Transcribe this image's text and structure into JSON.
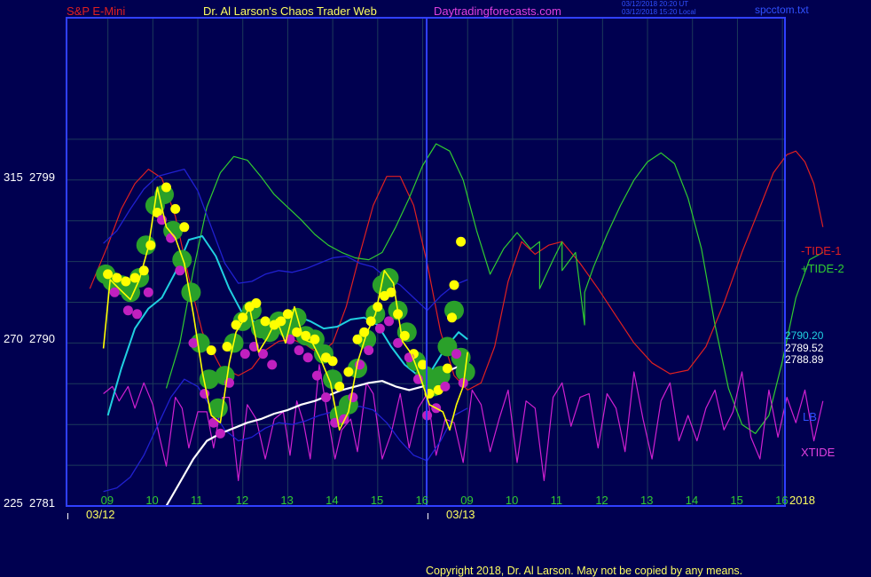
{
  "header": {
    "symbol": "S&P E-Mini",
    "title": "Dr. Al Larson's Chaos Trader Web",
    "site": "Daytradingforecasts.com",
    "stamp_utc": "03/12/2018 20:20 UT",
    "stamp_local": "03/12/2018 15:20 Local",
    "file": "spcctom.txt"
  },
  "colors": {
    "background": "#000050",
    "frame": "#3040ff",
    "grid": "#1c3a5a",
    "price": "#ffff00",
    "tide1": "#e02020",
    "tide2": "#30cc30",
    "xtide": "#d020d0",
    "band": "#2020d0",
    "cyan_ma": "#20d0e0",
    "white_ma": "#ffffff",
    "balls_green": "#2aa02a",
    "balls_yellow": "#ffff00",
    "balls_magenta": "#c020c0"
  },
  "chart_data": {
    "type": "line",
    "title": "S&P E-Mini",
    "y_axis": {
      "left_labels": [
        {
          "xtide": "315",
          "price": "2799"
        },
        {
          "xtide": "270",
          "price": "2790"
        },
        {
          "xtide": "225",
          "price": "2781"
        }
      ],
      "ylim": [
        2781,
        2799
      ]
    },
    "x_axis": {
      "hour_ticks": [
        "09",
        "10",
        "11",
        "12",
        "13",
        "14",
        "15",
        "16",
        "09",
        "10",
        "11",
        "12",
        "13",
        "14",
        "15",
        "16"
      ],
      "dates": [
        "03/12",
        "03/13"
      ],
      "year": "2018"
    },
    "right_labels": {
      "tide1": "-TIDE-1",
      "tide2": "+TIDE-2",
      "lb": "LB",
      "xtide": "XTIDE",
      "values": [
        "2790.20",
        "2789.52",
        "2788.89"
      ]
    },
    "series": [
      {
        "name": "-TIDE-1",
        "x": [
          -0.4,
          0,
          0.3,
          0.6,
          0.9,
          1.2,
          1.5,
          1.8,
          2.1,
          2.5,
          2.9,
          3.2,
          3.5,
          3.8,
          4.1,
          4.4,
          4.7,
          5.0,
          5.3,
          5.6,
          5.9,
          6.2,
          6.5,
          6.8,
          7.1,
          7.4,
          7.7,
          8.0,
          8.3,
          8.6,
          8.9,
          9.2,
          9.5,
          9.8,
          10.1,
          10.5,
          10.9,
          11.3,
          11.7,
          12.1,
          12.5,
          12.9,
          13.3,
          13.7,
          14.1,
          14.5,
          14.8,
          15.1,
          15.3,
          15.5,
          15.7,
          15.9
        ],
        "values": [
          2793.0,
          2795.4,
          2797.4,
          2798.8,
          2799.6,
          2799.1,
          2797.0,
          2793.6,
          2790.6,
          2788.7,
          2788.2,
          2788.6,
          2789.6,
          2790.1,
          2790.2,
          2789.9,
          2789.4,
          2790.0,
          2792.0,
          2794.9,
          2797.6,
          2799.2,
          2799.2,
          2797.6,
          2794.4,
          2790.6,
          2788.2,
          2787.4,
          2787.8,
          2789.8,
          2793.4,
          2795.6,
          2794.9,
          2795.4,
          2795.6,
          2794.4,
          2793.0,
          2791.5,
          2790.0,
          2788.9,
          2788.3,
          2788.5,
          2789.8,
          2792.2,
          2795.0,
          2797.5,
          2799.4,
          2800.4,
          2800.6,
          2800.0,
          2798.8,
          2796.4
        ]
      },
      {
        "name": "+TIDE-2",
        "x": [
          1.3,
          1.6,
          1.9,
          2.2,
          2.5,
          2.8,
          3.1,
          3.4,
          3.7,
          4.0,
          4.3,
          4.6,
          4.9,
          5.2,
          5.5,
          5.8,
          6.1,
          6.4,
          6.7,
          7.0,
          7.3,
          7.6,
          7.9,
          8.2,
          8.5,
          8.8,
          9.1,
          9.4,
          9.6,
          9.6,
          9.9,
          10.1,
          10.1,
          10.4,
          10.6,
          10.6,
          10.8,
          11.1,
          11.4,
          11.7,
          12.0,
          12.3,
          12.6,
          12.9,
          13.2,
          13.5,
          13.8,
          14.1,
          14.4,
          14.7,
          15.0,
          15.3,
          15.6,
          15.9
        ],
        "values": [
          2787.5,
          2790.0,
          2794.0,
          2797.5,
          2799.4,
          2800.3,
          2800.1,
          2799.2,
          2798.2,
          2797.5,
          2796.8,
          2796.0,
          2795.4,
          2795.0,
          2794.7,
          2794.6,
          2795.0,
          2796.4,
          2798.0,
          2799.8,
          2801.0,
          2800.6,
          2799.0,
          2796.2,
          2793.8,
          2795.2,
          2796.1,
          2795.2,
          2795.6,
          2793.0,
          2794.6,
          2795.6,
          2794.0,
          2795.0,
          2791.0,
          2792.8,
          2794.2,
          2796.0,
          2797.6,
          2799.0,
          2800.0,
          2800.5,
          2799.9,
          2798.0,
          2795.2,
          2791.0,
          2787.5,
          2785.5,
          2785.0,
          2786.0,
          2789.0,
          2792.5,
          2794.6,
          2795.0
        ]
      },
      {
        "name": "XTIDE",
        "x": [
          -0.1,
          0.1,
          0.25,
          0.45,
          0.6,
          0.8,
          1.0,
          1.15,
          1.3,
          1.5,
          1.65,
          1.8,
          2.0,
          2.2,
          2.35,
          2.55,
          2.7,
          2.9,
          3.1,
          3.3,
          3.5,
          3.7,
          3.9,
          4.05,
          4.2,
          4.35,
          4.5,
          4.7,
          4.9,
          5.05,
          5.2,
          5.4,
          5.55,
          5.75,
          5.9,
          6.1,
          6.3,
          6.5,
          6.7,
          6.9,
          7.1,
          7.3,
          7.5,
          7.7,
          7.9,
          8.1,
          8.3,
          8.5,
          8.7,
          8.9,
          9.1,
          9.3,
          9.5,
          9.7,
          9.9,
          10.1,
          10.3,
          10.5,
          10.7,
          10.9,
          11.1,
          11.3,
          11.5,
          11.7,
          11.9,
          12.1,
          12.3,
          12.5,
          12.7,
          12.9,
          13.1,
          13.3,
          13.5,
          13.7,
          13.9,
          14.1,
          14.3,
          14.5,
          14.7,
          14.9,
          15.1,
          15.3,
          15.5,
          15.7,
          15.9
        ],
        "values": [
          256,
          258,
          254,
          258,
          252,
          259,
          253,
          244,
          236,
          255,
          252,
          241,
          251,
          251,
          241,
          255,
          255,
          232,
          253,
          249,
          238,
          249,
          251,
          239,
          254,
          248,
          238,
          264,
          249,
          238,
          246,
          249,
          240,
          259,
          256,
          238,
          245,
          256,
          241,
          252,
          256,
          239,
          249,
          248,
          237,
          257,
          253,
          240,
          249,
          257,
          237,
          254,
          252,
          232,
          255,
          259,
          247,
          255,
          256,
          241,
          256,
          252,
          240,
          262,
          249,
          238,
          254,
          259,
          243,
          250,
          243,
          252,
          257,
          246,
          251,
          262,
          244,
          238,
          257,
          244,
          255,
          248,
          257,
          243,
          254
        ]
      },
      {
        "name": "LB",
        "x": [
          -0.1,
          0.2,
          0.5,
          0.8,
          1.1,
          1.4,
          1.7,
          2.0,
          2.3,
          2.6,
          2.9,
          3.2,
          3.5,
          3.8,
          4.1,
          4.4,
          4.7,
          5.0,
          5.3,
          5.6,
          5.9,
          6.2,
          6.5,
          6.8,
          7.1,
          7.4,
          7.7,
          8.0
        ],
        "values": [
          2781.8,
          2782.0,
          2782.6,
          2783.8,
          2785.4,
          2787.0,
          2788.0,
          2787.6,
          2786.4,
          2785.2,
          2784.6,
          2784.8,
          2785.3,
          2785.6,
          2785.5,
          2785.7,
          2786.0,
          2786.2,
          2786.4,
          2786.5,
          2786.3,
          2785.6,
          2784.6,
          2783.8,
          2783.5,
          2784.6,
          2786.0,
          2786.4
        ]
      },
      {
        "name": "Upper band",
        "x": [
          -0.1,
          0.2,
          0.5,
          0.8,
          1.1,
          1.4,
          1.7,
          2.0,
          2.3,
          2.6,
          2.9,
          3.2,
          3.5,
          3.8,
          4.1,
          4.4,
          4.7,
          5.0,
          5.3,
          5.6,
          5.9,
          6.2,
          6.5,
          6.8,
          7.1,
          7.4,
          7.7,
          8.0
        ],
        "values": [
          2795.5,
          2796.2,
          2797.4,
          2798.5,
          2799.2,
          2799.4,
          2799.6,
          2798.4,
          2796.4,
          2794.4,
          2793.3,
          2793.4,
          2793.8,
          2794.0,
          2793.9,
          2794.1,
          2794.4,
          2794.7,
          2794.8,
          2794.4,
          2794.2,
          2793.6,
          2793.2,
          2792.5,
          2791.8,
          2792.6,
          2793.2,
          2793.5
        ]
      },
      {
        "name": "Cyan MA",
        "x": [
          0.0,
          0.3,
          0.6,
          0.9,
          1.2,
          1.5,
          1.8,
          2.1,
          2.4,
          2.7,
          3.0,
          3.3,
          3.6,
          3.9,
          4.2,
          4.5,
          4.8,
          5.1,
          5.4,
          5.7,
          6.0,
          6.3,
          6.6,
          6.9,
          7.2,
          7.5,
          7.8,
          8.0
        ],
        "values": [
          2786.0,
          2788.6,
          2790.8,
          2791.9,
          2792.5,
          2793.9,
          2795.7,
          2795.9,
          2794.8,
          2793.0,
          2791.6,
          2791.1,
          2791.0,
          2791.3,
          2791.5,
          2791.2,
          2790.8,
          2790.9,
          2791.3,
          2791.4,
          2791.0,
          2789.8,
          2788.8,
          2788.2,
          2788.5,
          2789.7,
          2790.6,
          2790.2
        ]
      },
      {
        "name": "White MA",
        "x": [
          1.3,
          1.6,
          1.9,
          2.2,
          2.5,
          2.8,
          3.1,
          3.4,
          3.7,
          4.0,
          4.3,
          4.6,
          4.9,
          5.2,
          5.5,
          5.8,
          6.1,
          6.4,
          6.7,
          7.0,
          7.3,
          7.6,
          7.9,
          8.0
        ],
        "values": [
          2781.0,
          2782.3,
          2783.6,
          2784.6,
          2785.0,
          2785.3,
          2785.6,
          2785.8,
          2786.1,
          2786.3,
          2786.6,
          2786.8,
          2787.1,
          2787.4,
          2787.6,
          2787.8,
          2787.9,
          2787.6,
          2787.4,
          2787.6,
          2788.0,
          2788.5,
          2788.8,
          2788.9
        ]
      },
      {
        "name": "Price",
        "x": [
          -0.1,
          0.05,
          0.25,
          0.5,
          0.7,
          0.9,
          1.1,
          1.3,
          1.5,
          1.7,
          1.9,
          2.1,
          2.3,
          2.5,
          2.7,
          2.85,
          3.0,
          3.15,
          3.35,
          3.55,
          3.75,
          3.95,
          4.15,
          4.35,
          4.55,
          4.75,
          4.95,
          5.15,
          5.35,
          5.55,
          5.75,
          5.95,
          6.15,
          6.35,
          6.55,
          6.75,
          6.95,
          7.15,
          7.3,
          7.45,
          7.6,
          7.75,
          7.9,
          8.0
        ],
        "values": [
          2789.7,
          2793.5,
          2793.0,
          2792.4,
          2793.5,
          2795.3,
          2798.6,
          2796.4,
          2795.8,
          2794.4,
          2791.6,
          2788.4,
          2786.0,
          2785.6,
          2788.9,
          2790.6,
          2791.2,
          2792.0,
          2789.5,
          2790.3,
          2791.3,
          2790.0,
          2792.0,
          2790.2,
          2790.0,
          2789.0,
          2787.8,
          2785.2,
          2786.2,
          2788.9,
          2790.5,
          2791.6,
          2794.0,
          2793.3,
          2790.1,
          2789.4,
          2788.1,
          2786.6,
          2786.4,
          2786.2,
          2785.2,
          2786.6,
          2787.6,
          2789.5
        ]
      },
      {
        "name": "Green balls",
        "x": [
          -0.05,
          0.1,
          0.3,
          0.5,
          0.7,
          0.85,
          1.05,
          1.25,
          1.45,
          1.65,
          1.85,
          2.05,
          2.25,
          2.45,
          2.6,
          2.8,
          3.0,
          3.2,
          3.4,
          3.6,
          3.8,
          4.0,
          4.2,
          4.4,
          4.6,
          4.8,
          5.0,
          5.15,
          5.35,
          5.55,
          5.75,
          5.95,
          6.1,
          6.25,
          6.45,
          6.65,
          6.85,
          7.05,
          7.25,
          7.4,
          7.55,
          7.7,
          7.85,
          7.95
        ],
        "values": [
          2793.8,
          2793.4,
          2793.2,
          2792.8,
          2793.6,
          2795.4,
          2797.6,
          2798.2,
          2796.2,
          2794.6,
          2792.8,
          2790.0,
          2788.0,
          2786.4,
          2788.2,
          2790.0,
          2791.2,
          2791.8,
          2790.8,
          2790.6,
          2791.2,
          2790.8,
          2791.4,
          2790.4,
          2790.2,
          2789.4,
          2788.0,
          2786.0,
          2786.6,
          2788.6,
          2790.2,
          2791.6,
          2793.2,
          2793.6,
          2791.8,
          2790.6,
          2789.0,
          2788.2,
          2787.6,
          2788.2,
          2789.8,
          2791.8,
          2789.2,
          2788.4
        ]
      },
      {
        "name": "Yellow balls",
        "x": [
          0.0,
          0.2,
          0.4,
          0.6,
          0.8,
          0.95,
          1.1,
          1.3,
          1.5,
          1.7,
          2.3,
          2.65,
          2.85,
          3.0,
          3.15,
          3.3,
          3.5,
          3.7,
          3.85,
          4.0,
          4.2,
          4.4,
          4.6,
          4.85,
          5.0,
          5.15,
          5.35,
          5.55,
          5.7,
          5.85,
          6.0,
          6.15,
          6.3,
          6.45,
          6.6,
          6.8,
          7.0,
          7.15,
          7.35,
          7.55,
          7.65
        ],
        "values": [
          2793.8,
          2793.6,
          2793.4,
          2793.6,
          2794.0,
          2795.4,
          2797.2,
          2798.6,
          2797.4,
          2796.4,
          2789.6,
          2789.8,
          2791.0,
          2791.4,
          2792.0,
          2792.2,
          2791.2,
          2791.0,
          2791.2,
          2791.6,
          2790.6,
          2790.4,
          2790.2,
          2789.2,
          2789.0,
          2787.6,
          2788.4,
          2790.2,
          2790.6,
          2791.2,
          2792.0,
          2792.6,
          2792.8,
          2791.6,
          2790.4,
          2789.4,
          2788.8,
          2787.2,
          2787.4,
          2788.6,
          2791.4
        ],
        "values2_x": [
          7.7,
          7.85
        ],
        "values2": [
          2793.2,
          2795.6
        ]
      },
      {
        "name": "Magenta balls",
        "x": [
          0.15,
          0.45,
          0.65,
          0.9,
          1.2,
          1.4,
          1.6,
          1.9,
          2.15,
          2.35,
          2.5,
          2.7,
          3.05,
          3.25,
          3.45,
          3.65,
          4.05,
          4.25,
          4.45,
          4.65,
          4.85,
          5.05,
          5.25,
          5.45,
          5.6,
          5.8,
          6.05,
          6.25,
          6.45,
          6.7,
          6.9,
          7.1,
          7.3,
          7.5,
          7.75,
          7.9
        ],
        "values": [
          2792.8,
          2791.8,
          2791.6,
          2792.8,
          2796.8,
          2795.8,
          2794.0,
          2790.0,
          2787.2,
          2785.6,
          2785.0,
          2787.8,
          2789.4,
          2789.8,
          2789.4,
          2788.8,
          2790.2,
          2789.6,
          2789.2,
          2788.2,
          2787.0,
          2785.6,
          2785.8,
          2787.0,
          2788.8,
          2789.6,
          2790.8,
          2791.2,
          2790.0,
          2789.2,
          2788.0,
          2786.0,
          2786.4,
          2787.6,
          2789.4,
          2787.8
        ]
      }
    ]
  },
  "footer": {
    "copyright": "Copyright 2018, Dr. Al Larson. May not be copied by any means."
  }
}
